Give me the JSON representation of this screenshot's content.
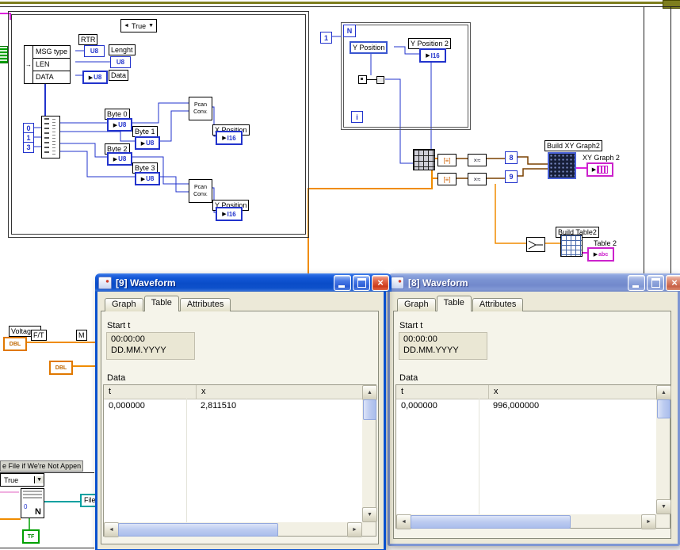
{
  "icons": {
    "case_prev": "◄",
    "dropdown": "▼",
    "terminal_in": "▶",
    "close": "×",
    "scroll_up": "▲",
    "scroll_down": "▼",
    "scroll_left": "◄",
    "scroll_right": "►",
    "unbundle_arrow": "→",
    "convert_a": "[≡]",
    "convert_b": "×≈"
  },
  "diagram": {
    "case_selector": "True",
    "cluster": {
      "row0": "MSG type",
      "row1": "LEN",
      "row2": "DATA",
      "rtr": "RTR",
      "lenght": "Lenght",
      "data": "Data",
      "u8": "U8"
    },
    "consts": {
      "c0": "0",
      "c1": "1",
      "c3": "3"
    },
    "bytes": {
      "b0": "Byte 0",
      "b1": "Byte 1",
      "b2": "Byte 2",
      "b3": "Byte 3",
      "u8": "U8"
    },
    "pcan": {
      "line1": "Pcan",
      "line2": "Conv."
    },
    "xpos": "X Position",
    "ypos": "Y Position",
    "i16": "I16",
    "loop": {
      "n": "N",
      "i": "i",
      "const1": "1",
      "local": "Y Position",
      "ypos2": "Y Position 2"
    },
    "nums": {
      "n8": "8",
      "n9": "9"
    },
    "xy": {
      "title": "Build XY Graph2",
      "terminal": "XY Graph 2"
    },
    "tbl": {
      "title": "Build Table2",
      "terminal": "Table 2",
      "abc": "abc"
    },
    "io": {
      "voltages": "Voltages",
      "ft": "F/T",
      "m": "M",
      "dbl": "DBL"
    },
    "bottom": {
      "file_label": "e File if We're Not Appen",
      "case_true": "True",
      "filename": "Filenam",
      "tf": "TF",
      "zero": "0",
      "n": "N"
    }
  },
  "windows": [
    {
      "title": "[9] Waveform",
      "tabs": [
        "Graph",
        "Table",
        "Attributes"
      ],
      "start_label": "Start t",
      "time": "00:00:00",
      "date": "DD.MM.YYYY",
      "data_label": "Data",
      "columns": [
        "t",
        "x"
      ],
      "rows": [
        [
          "0,000000",
          "2,811510"
        ]
      ]
    },
    {
      "title": "[8] Waveform",
      "tabs": [
        "Graph",
        "Table",
        "Attributes"
      ],
      "start_label": "Start t",
      "time": "00:00:00",
      "date": "DD.MM.YYYY",
      "data_label": "Data",
      "columns": [
        "t",
        "x"
      ],
      "rows": [
        [
          "0,000000",
          "996,000000"
        ]
      ]
    }
  ]
}
